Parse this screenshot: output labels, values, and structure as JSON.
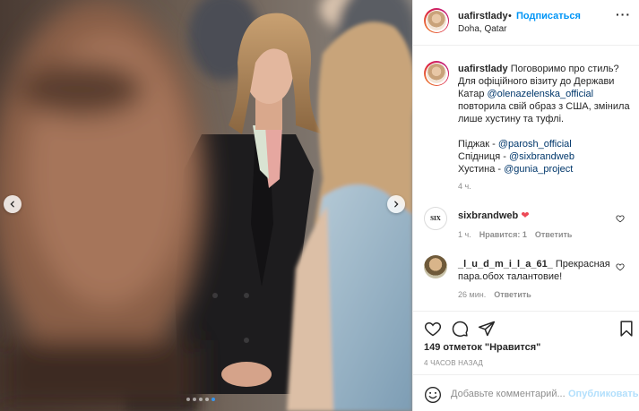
{
  "post": {
    "username": "uafirstlady",
    "separator": "•",
    "follow_label": "Подписаться",
    "location": "Doha, Qatar",
    "more_label": "···",
    "caption": {
      "line1": "Поговоримо про стиль? Для офіційного візиту до Держави Катар ",
      "mention1": "@olenazelenska_official",
      "line2": " повторила свій образ з США, змінила лише хустину та туфлі.",
      "item1_label": "Піджак - ",
      "item1_link": "@parosh_official",
      "item2_label": "Спідниця - ",
      "item2_link": "@sixbrandweb",
      "item3_label": "Хустина - ",
      "item3_link": "@gunia_project",
      "time": "4 ч."
    },
    "comments": [
      {
        "username": "sixbrandweb",
        "text": "❤",
        "avatar_text": "SIX",
        "time": "1 ч.",
        "likes": "Нравится: 1",
        "reply": "Ответить"
      },
      {
        "username": "_l_u_d_m_i_l_a_61_",
        "text": "Прекрасная пара.обох талантовие!",
        "time": "26 мин.",
        "reply": "Ответить"
      }
    ],
    "likes_text": "149 отметок \"Нравится\"",
    "posted_ago": "4 ЧАСОВ НАЗАД",
    "comment_placeholder": "Добавьте комментарий...",
    "publish_label": "Опубликовать"
  },
  "carousel": {
    "total": 5,
    "active_index": 4
  },
  "colors": {
    "link": "#00376b",
    "follow": "#0095f6",
    "publish_disabled": "#b2dffc",
    "secondary_text": "#8e8e8e",
    "heart_red": "#ed4956"
  },
  "icons": {
    "prev": "chevron-left-icon",
    "next": "chevron-right-icon",
    "like": "heart-icon",
    "comment": "comment-icon",
    "share": "paper-plane-icon",
    "save": "bookmark-icon",
    "emoji": "smiley-icon"
  }
}
